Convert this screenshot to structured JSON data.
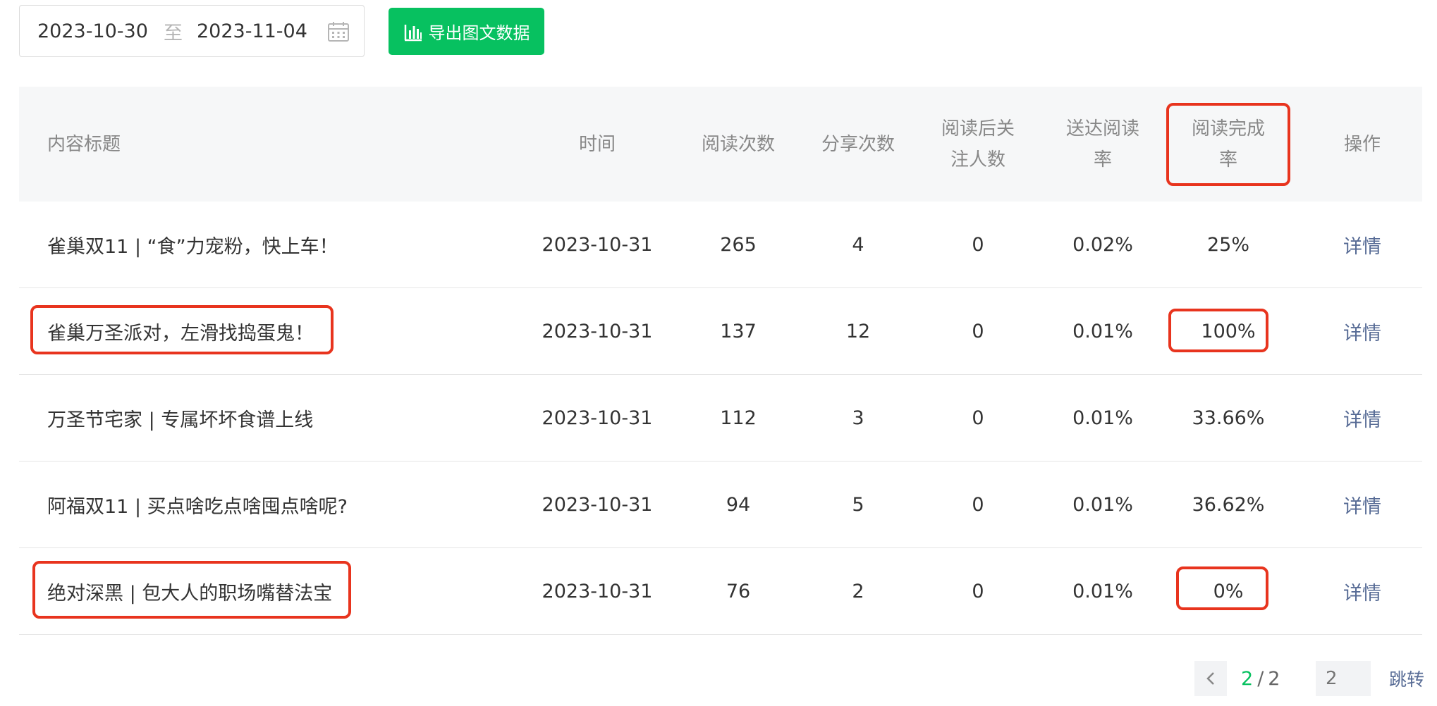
{
  "filter": {
    "start_date": "2023-10-30",
    "separator": "至",
    "end_date": "2023-11-04",
    "calendar_icon": "calendar-icon"
  },
  "export": {
    "label": "导出图文数据",
    "icon": "bar-chart-icon",
    "color": "#07c160"
  },
  "table": {
    "headers": {
      "title": "内容标题",
      "time": "时间",
      "reads": "阅读次数",
      "shares": "分享次数",
      "follows_l1": "阅读后关",
      "follows_l2": "注人数",
      "deliver_l1": "送达阅读",
      "deliver_l2": "率",
      "complete_l1": "阅读完成",
      "complete_l2": "率",
      "op": "操作"
    },
    "rows": [
      {
        "title": "雀巢双11 | “食”力宠粉，快上车！",
        "time": "2023-10-31",
        "reads": "265",
        "shares": "4",
        "follows": "0",
        "deliver": "0.02%",
        "complete": "25%",
        "op": "详情"
      },
      {
        "title": "雀巢万圣派对，左滑找捣蛋鬼！",
        "time": "2023-10-31",
        "reads": "137",
        "shares": "12",
        "follows": "0",
        "deliver": "0.01%",
        "complete": "100%",
        "op": "详情"
      },
      {
        "title": "万圣节宅家 | 专属坏坏食谱上线",
        "time": "2023-10-31",
        "reads": "112",
        "shares": "3",
        "follows": "0",
        "deliver": "0.01%",
        "complete": "33.66%",
        "op": "详情"
      },
      {
        "title": "阿福双11 | 买点啥吃点啥囤点啥呢?",
        "time": "2023-10-31",
        "reads": "94",
        "shares": "5",
        "follows": "0",
        "deliver": "0.01%",
        "complete": "36.62%",
        "op": "详情"
      },
      {
        "title": "绝对深黑 | 包大人的职场嘴替法宝",
        "time": "2023-10-31",
        "reads": "76",
        "shares": "2",
        "follows": "0",
        "deliver": "0.01%",
        "complete": "0%",
        "op": "详情"
      }
    ]
  },
  "pagination": {
    "current": "2",
    "slash": "/",
    "total": "2",
    "input_placeholder": "2",
    "jump_label": "跳转"
  },
  "colors": {
    "accent_green": "#07c160",
    "link_blue": "#576b95",
    "highlight_red": "#e8341e",
    "header_bg": "#f6f7f8"
  }
}
